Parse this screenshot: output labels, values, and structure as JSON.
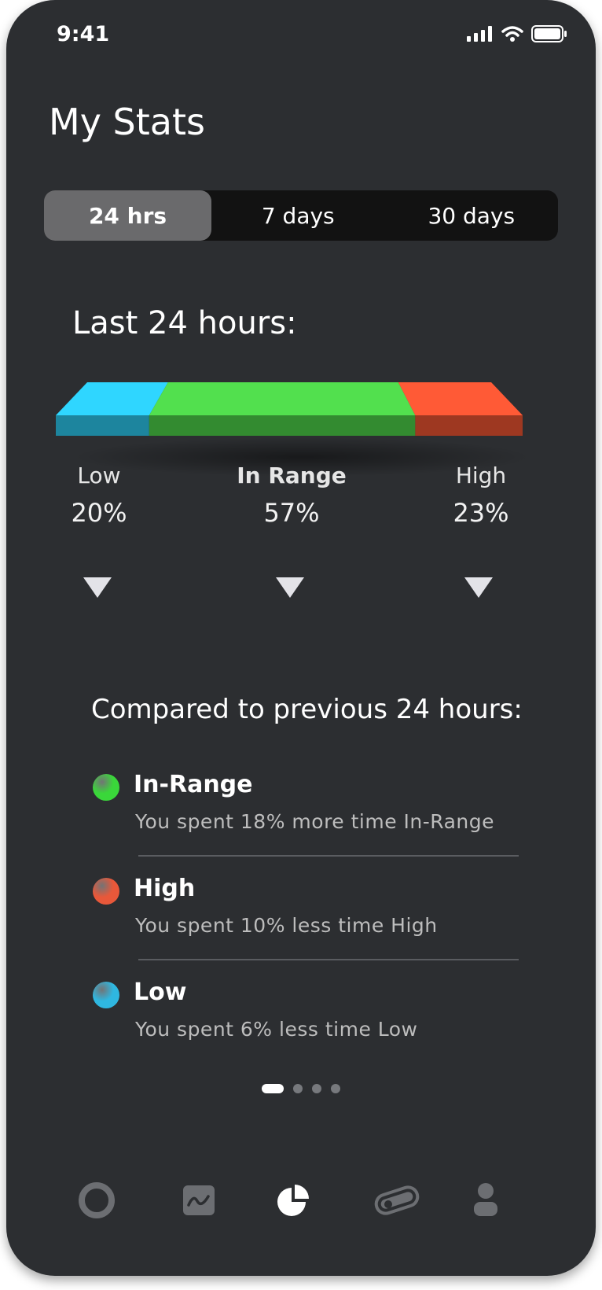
{
  "status_bar": {
    "time": "9:41"
  },
  "header": {
    "title": "My Stats"
  },
  "segments": [
    {
      "label": "24 hrs",
      "active": true
    },
    {
      "label": "7 days",
      "active": false
    },
    {
      "label": "30 days",
      "active": false
    }
  ],
  "summary": {
    "title": "Last 24 hours:",
    "bar_fractions": {
      "low": 0.2,
      "in_range": 0.57,
      "high": 0.23
    },
    "colors": {
      "low": "#2fd6ff",
      "in_range": "#52e04e",
      "high": "#ff5a36"
    },
    "categories": [
      {
        "label": "Low",
        "percent": "20%"
      },
      {
        "label": "In Range",
        "percent": "57%"
      },
      {
        "label": "High",
        "percent": "23%"
      }
    ]
  },
  "comparison": {
    "title": "Compared to previous 24 hours:",
    "items": [
      {
        "name": "In-Range",
        "description": "You spent 18% more time In-Range",
        "color": "#3ad73a"
      },
      {
        "name": "High",
        "description": "You spent 10% less time High",
        "color": "#e8583a"
      },
      {
        "name": "Low",
        "description": "You spent 6% less time Low",
        "color": "#2fb7e0"
      }
    ]
  },
  "pager": {
    "pages": 4,
    "current": 1
  },
  "tabbar": {
    "items": [
      "ring-icon",
      "trend-chart-icon",
      "pie-chart-icon",
      "sensor-pod-icon",
      "profile-icon"
    ],
    "active": "pie-chart-icon"
  }
}
